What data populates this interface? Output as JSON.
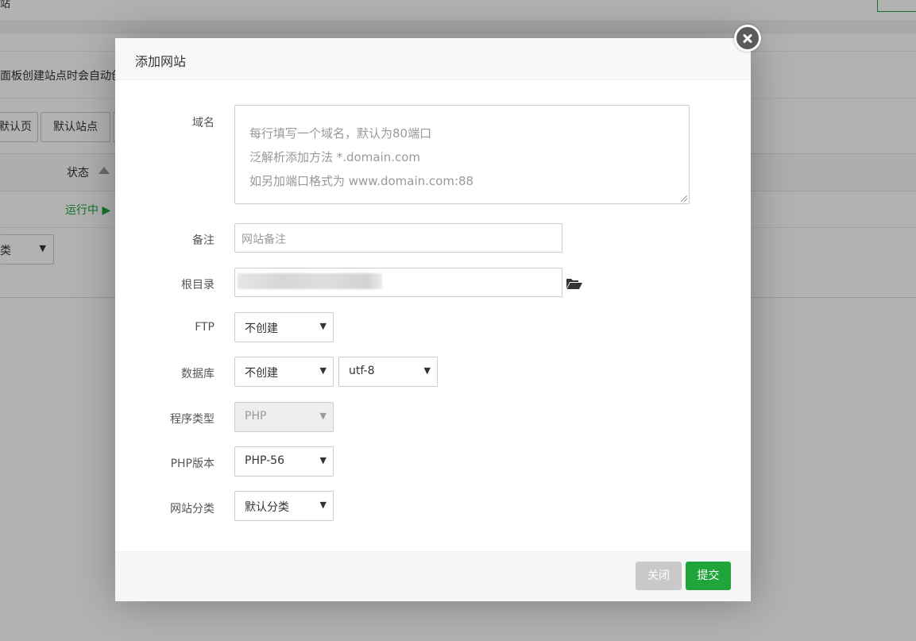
{
  "background": {
    "top_title": "站",
    "notice": "面板创建站点时会自动创",
    "buttons": [
      "默认页",
      "默认站点"
    ],
    "table_header_status": "状态",
    "row_status": "运行中 ▶",
    "category_select": "类"
  },
  "modal": {
    "title": "添加网站",
    "domain": {
      "label": "域名",
      "placeholder_lines": [
        "每行填写一个域名，默认为80端口",
        "泛解析添加方法 *.domain.com",
        "如另加端口格式为 www.domain.com:88"
      ]
    },
    "remark": {
      "label": "备注",
      "placeholder": "网站备注"
    },
    "root_dir": {
      "label": "根目录",
      "value": ""
    },
    "ftp": {
      "label": "FTP",
      "selected": "不创建"
    },
    "database": {
      "label": "数据库",
      "selected": "不创建",
      "charset": "utf-8"
    },
    "program_type": {
      "label": "程序类型",
      "selected": "PHP"
    },
    "php_version": {
      "label": "PHP版本",
      "selected": "PHP-56"
    },
    "site_category": {
      "label": "网站分类",
      "selected": "默认分类"
    },
    "close_label": "关闭",
    "submit_label": "提交"
  },
  "colors": {
    "accent": "#20a53a",
    "close_bg": "#5a5a5a"
  },
  "icons": [
    "close-icon",
    "folder-open-icon",
    "caret-down-icon",
    "sort-asc-icon"
  ]
}
